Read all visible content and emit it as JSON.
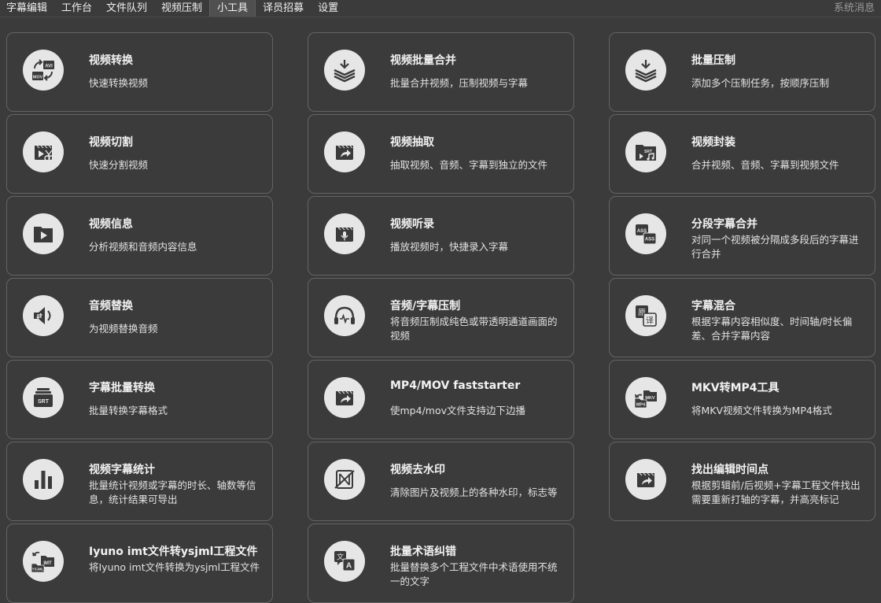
{
  "menu": {
    "items": [
      "字幕编辑",
      "工作台",
      "文件队列",
      "视频压制",
      "小工具",
      "译员招募",
      "设置"
    ],
    "active_index": 4,
    "system_message": "系统消息"
  },
  "tools": [
    {
      "title": "视频转换",
      "desc": "快速转换视频",
      "icon": "video-convert-icon"
    },
    {
      "title": "视频批量合并",
      "desc": "批量合并视频，压制视频与字幕",
      "icon": "layers-download-icon"
    },
    {
      "title": "批量压制",
      "desc": "添加多个压制任务，按顺序压制",
      "icon": "layers-download-icon"
    },
    {
      "title": "视频切割",
      "desc": "快速分割视频",
      "icon": "video-cut-icon"
    },
    {
      "title": "视频抽取",
      "desc": "抽取视频、音频、字幕到独立的文件",
      "icon": "video-share-icon"
    },
    {
      "title": "视频封装",
      "desc": "合并视频、音频、字幕到视频文件",
      "icon": "video-mux-icon"
    },
    {
      "title": "视频信息",
      "desc": "分析视频和音频内容信息",
      "icon": "video-info-icon"
    },
    {
      "title": "视频听录",
      "desc": "播放视频时，快捷录入字幕",
      "icon": "video-mic-icon"
    },
    {
      "title": "分段字幕合并",
      "desc": "对同一个视频被分隔成多段后的字幕进行合并",
      "icon": "ass-merge-icon"
    },
    {
      "title": "音频替换",
      "desc": "为视频替换音频",
      "icon": "speaker-swap-icon"
    },
    {
      "title": "音频/字幕压制",
      "desc": "将音频压制成纯色或带透明通道画面的视频",
      "icon": "headphones-icon"
    },
    {
      "title": "字幕混合",
      "desc": "根据字幕内容相似度、时间轴/时长偏差、合并字幕内容",
      "icon": "translate-mix-icon"
    },
    {
      "title": "字幕批量转换",
      "desc": "批量转换字幕格式",
      "icon": "srt-stack-icon"
    },
    {
      "title": "MP4/MOV faststarter",
      "desc": "使mp4/mov文件支持边下边播",
      "icon": "video-share-icon"
    },
    {
      "title": "MKV转MP4工具",
      "desc": "将MKV视频文件转换为MP4格式",
      "icon": "mkv-mp4-icon"
    },
    {
      "title": "视频字幕统计",
      "desc": "批量统计视频或字幕的时长、轴数等信息，统计结果可导出",
      "icon": "bar-chart-icon"
    },
    {
      "title": "视频去水印",
      "desc": "清除图片及视频上的各种水印，标志等",
      "icon": "watermark-remove-icon"
    },
    {
      "title": "找出编辑时间点",
      "desc": "根据剪辑前/后视频+字幕工程文件找出需要重新打轴的字幕，并高亮标记",
      "icon": "video-share-icon"
    },
    {
      "title": "Iyuno imt文件转ysjml工程文件",
      "desc": "将Iyuno imt文件转换为ysjml工程文件",
      "icon": "imt-convert-icon"
    },
    {
      "title": "批量术语纠错",
      "desc": "批量替换多个工程文件中术语使用不统一的文字",
      "icon": "translate-a-icon"
    }
  ],
  "icon_labels": {
    "avi": "AVI",
    "mov": "MOV",
    "srt": "SRT",
    "ass": "ASS",
    "mp4": "MP4",
    "mkv": "MKV",
    "ysjml": "YSJML",
    "imt": "IMT",
    "yuan": "原",
    "yi": "译",
    "wen": "文",
    "a": "A"
  },
  "colors": {
    "background": "#3b3b3b",
    "card_border": "#646464",
    "icon_bg": "#e6e6e6",
    "icon_fg": "#3a3a3a"
  }
}
